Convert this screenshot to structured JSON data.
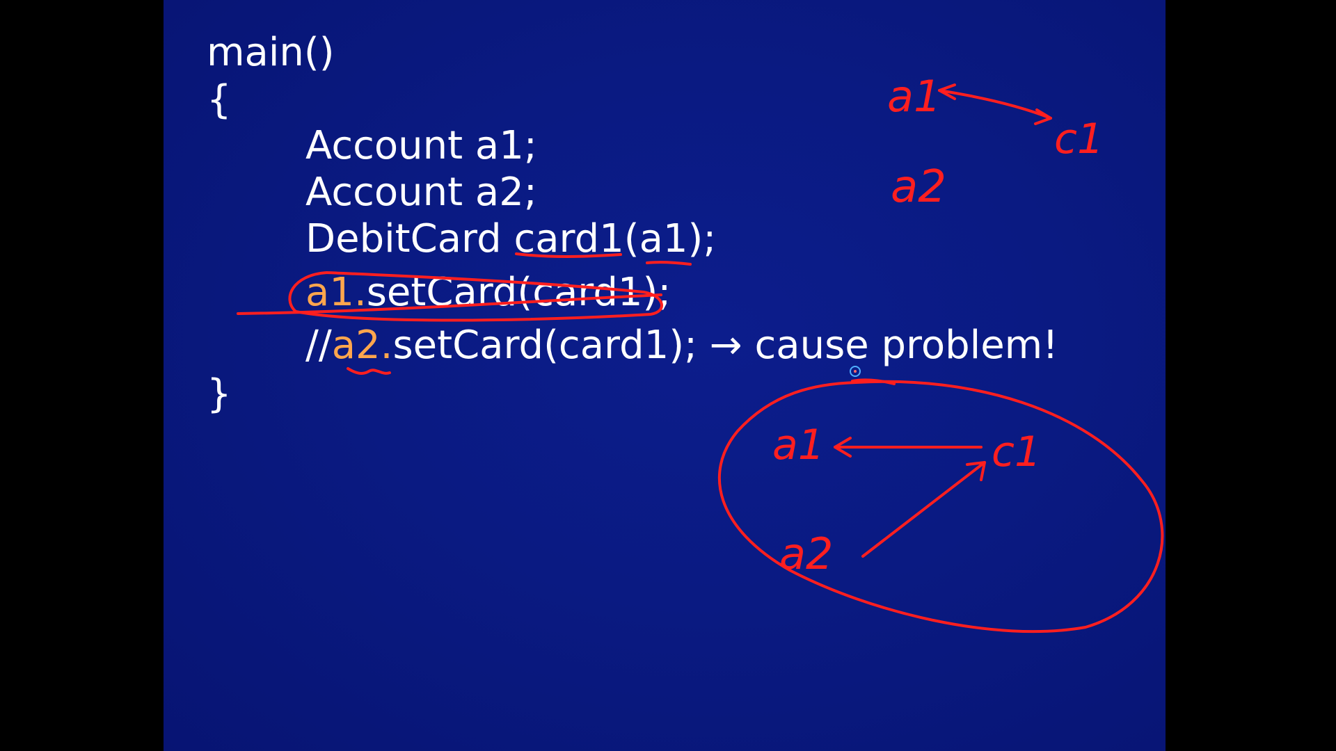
{
  "slide": {
    "lines": [
      {
        "text": "main()"
      },
      {
        "text": "{"
      },
      {
        "text": "Account a1;"
      },
      {
        "text": "Account a2;"
      },
      {
        "text": "DebitCard card1(a1);"
      },
      {
        "highlight": "a1.",
        "text": "setCard(card1);"
      },
      {
        "prefix": "//",
        "highlight": "a2.",
        "text": "setCard(card1); → cause problem!"
      },
      {
        "text": "}"
      }
    ]
  },
  "annotations": {
    "top_diagram": {
      "a1": "a1",
      "c1": "c1",
      "a2": "a2"
    },
    "circle_diagram": {
      "a1": "a1",
      "c1": "c1",
      "a2": "a2"
    },
    "ink_color": "#ff1f1f"
  },
  "colors": {
    "slide_background": "#0a1a82",
    "code_text": "#ffffff",
    "highlight_text": "#ffa64d",
    "page_background": "#000000"
  }
}
